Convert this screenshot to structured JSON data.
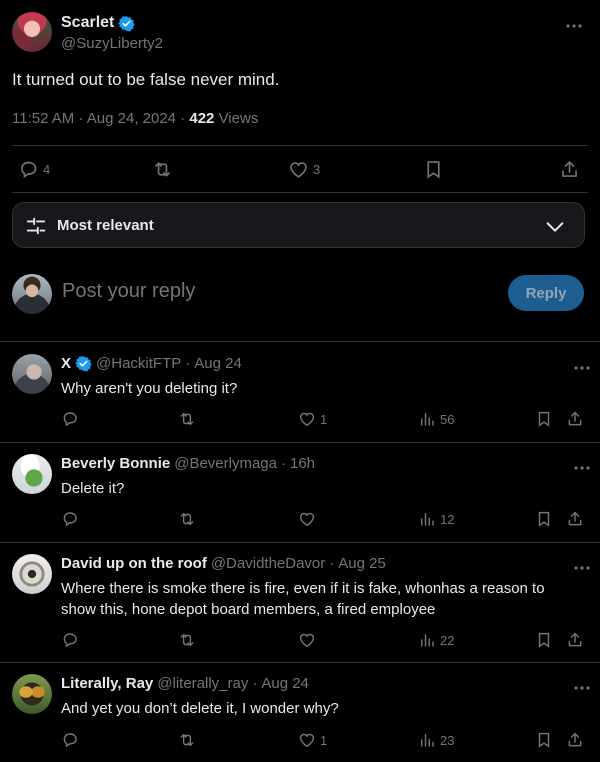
{
  "post": {
    "author_name": "Scarlet",
    "author_handle": "@SuzyLiberty2",
    "text": "It turned out to be false never mind.",
    "time": "11:52 AM",
    "date": "Aug 24, 2024",
    "views_count": "422",
    "views_label": "Views",
    "replies": "4",
    "likes": "3"
  },
  "sort": {
    "label": "Most relevant"
  },
  "composer": {
    "placeholder": "Post your reply",
    "button_label": "Reply"
  },
  "replies": [
    {
      "name": "X",
      "verified": true,
      "handle": "@HackitFTP",
      "date": "Aug 24",
      "text": "Why aren't you deleting it?",
      "likes": "1",
      "views": "56"
    },
    {
      "name": "Beverly Bonnie",
      "verified": false,
      "handle": "@Beverlymaga",
      "date": "16h",
      "text": "Delete it?",
      "likes": "",
      "views": "12"
    },
    {
      "name": "David up on the roof",
      "verified": false,
      "handle": "@DavidtheDavor",
      "date": "Aug 25",
      "text": "Where there is smoke there is fire, even if it is fake, whonhas a reason to show this, hone depot board members, a fired employee",
      "likes": "",
      "views": "22"
    },
    {
      "name": "Literally, Ray",
      "verified": false,
      "handle": "@literally_ray",
      "date": "Aug 24",
      "text": "And yet you don’t delete it, I wonder why?",
      "likes": "1",
      "views": "23"
    }
  ],
  "colors": {
    "accent": "#1d9bf0",
    "muted": "#71767b",
    "border": "#2f3336",
    "reply_button_bg": "#1d5d8f"
  },
  "icons": [
    "verified-badge-icon",
    "more-icon",
    "reply-icon",
    "repost-icon",
    "like-icon",
    "bookmark-icon",
    "share-icon",
    "views-icon",
    "sliders-icon",
    "chevron-down-icon"
  ]
}
